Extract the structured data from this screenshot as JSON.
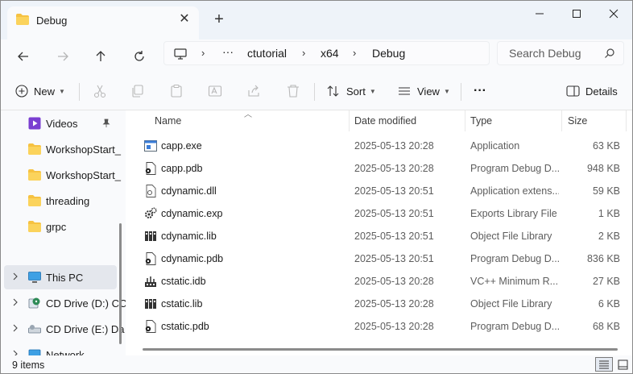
{
  "window": {
    "tab_title": "Debug"
  },
  "address": {
    "ellipsis": "···",
    "crumbs": [
      "ctutorial",
      "x64",
      "Debug"
    ],
    "search_placeholder": "Search Debug"
  },
  "commands": {
    "new_label": "New",
    "sort_label": "Sort",
    "view_label": "View",
    "more_label": "···",
    "details_label": "Details"
  },
  "nav": {
    "items": [
      {
        "label": "Videos"
      },
      {
        "label": "WorkshopStart_"
      },
      {
        "label": "WorkshopStart_"
      },
      {
        "label": "threading"
      },
      {
        "label": "grpc"
      },
      {
        "label": "This PC"
      },
      {
        "label": "CD Drive (D:) CC"
      },
      {
        "label": "CD Drive (E:) Da"
      },
      {
        "label": "Network"
      }
    ]
  },
  "columns": {
    "name": "Name",
    "date": "Date modified",
    "type": "Type",
    "size": "Size"
  },
  "files": [
    {
      "name": "capp.exe",
      "date": "2025-05-13 20:28",
      "type": "Application",
      "size": "63 KB",
      "icon": "exe-icon"
    },
    {
      "name": "capp.pdb",
      "date": "2025-05-13 20:28",
      "type": "Program Debug D...",
      "size": "948 KB",
      "icon": "pdb-icon"
    },
    {
      "name": "cdynamic.dll",
      "date": "2025-05-13 20:51",
      "type": "Application extens...",
      "size": "59 KB",
      "icon": "dll-icon"
    },
    {
      "name": "cdynamic.exp",
      "date": "2025-05-13 20:51",
      "type": "Exports Library File",
      "size": "1 KB",
      "icon": "exp-icon"
    },
    {
      "name": "cdynamic.lib",
      "date": "2025-05-13 20:51",
      "type": "Object File Library",
      "size": "2 KB",
      "icon": "lib-icon"
    },
    {
      "name": "cdynamic.pdb",
      "date": "2025-05-13 20:51",
      "type": "Program Debug D...",
      "size": "836 KB",
      "icon": "pdb-icon"
    },
    {
      "name": "cstatic.idb",
      "date": "2025-05-13 20:28",
      "type": "VC++ Minimum R...",
      "size": "27 KB",
      "icon": "idb-icon"
    },
    {
      "name": "cstatic.lib",
      "date": "2025-05-13 20:28",
      "type": "Object File Library",
      "size": "6 KB",
      "icon": "lib-icon"
    },
    {
      "name": "cstatic.pdb",
      "date": "2025-05-13 20:28",
      "type": "Program Debug D...",
      "size": "68 KB",
      "icon": "pdb-icon"
    }
  ],
  "status": {
    "count": "9 items"
  },
  "colors": {
    "folder": "#f6c242",
    "accent": "#0067c0",
    "selected_bg": "#e4e7ed",
    "chrome_bg": "#f9fafc",
    "title_bg": "#eef3f9"
  }
}
